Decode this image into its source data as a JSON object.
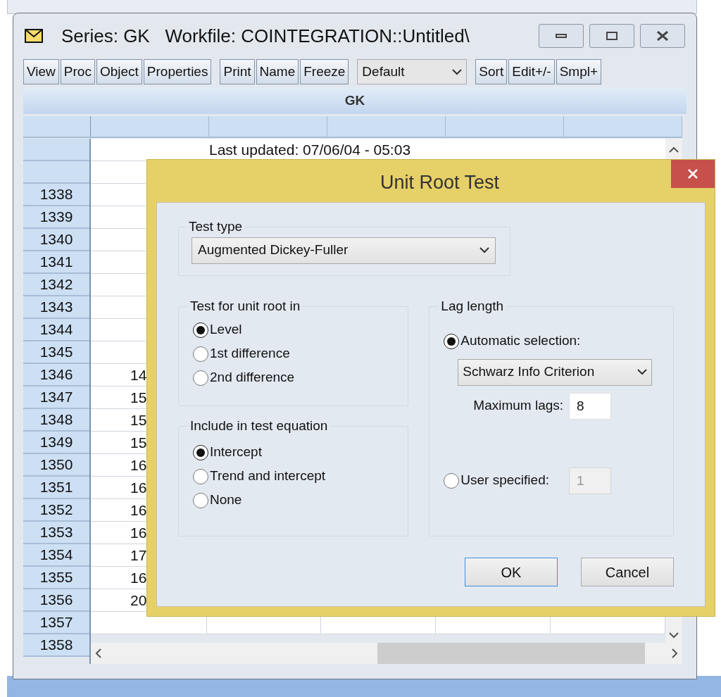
{
  "window": {
    "title": "Series: GK   Workfile: COINTEGRATION::Untitled\\"
  },
  "toolbar_groups": [
    [
      {
        "kind": "button",
        "label": "View"
      },
      {
        "kind": "button",
        "label": "Proc"
      },
      {
        "kind": "button",
        "label": "Object"
      },
      {
        "kind": "button",
        "label": "Properties"
      }
    ],
    [
      {
        "kind": "button",
        "label": "Print"
      },
      {
        "kind": "button",
        "label": "Name"
      },
      {
        "kind": "button",
        "label": "Freeze"
      }
    ],
    [
      {
        "kind": "dropdown",
        "label": "Default"
      }
    ],
    [
      {
        "kind": "button",
        "label": "Sort"
      },
      {
        "kind": "button",
        "label": "Edit+/-"
      },
      {
        "kind": "button",
        "label": "Smpl+"
      }
    ]
  ],
  "series_header": "GK",
  "sheet": {
    "note": "Last updated: 07/06/04 - 05:03",
    "rows": [
      {
        "label": "",
        "value": ""
      },
      {
        "label": "1338",
        "value": ""
      },
      {
        "label": "1339",
        "value": ""
      },
      {
        "label": "1340",
        "value": ""
      },
      {
        "label": "1341",
        "value": ""
      },
      {
        "label": "1342",
        "value": ""
      },
      {
        "label": "1343",
        "value": ""
      },
      {
        "label": "1344",
        "value": ""
      },
      {
        "label": "1345",
        "value": ""
      },
      {
        "label": "1346",
        "value": "14"
      },
      {
        "label": "1347",
        "value": "15"
      },
      {
        "label": "1348",
        "value": "15"
      },
      {
        "label": "1349",
        "value": "15"
      },
      {
        "label": "1350",
        "value": "16"
      },
      {
        "label": "1351",
        "value": "16"
      },
      {
        "label": "1352",
        "value": "16"
      },
      {
        "label": "1353",
        "value": "16"
      },
      {
        "label": "1354",
        "value": "17"
      },
      {
        "label": "1355",
        "value": "16"
      },
      {
        "label": "1356",
        "value": "20"
      },
      {
        "label": "1357",
        "value": ""
      },
      {
        "label": "1358",
        "value": ""
      }
    ]
  },
  "dialog": {
    "title": "Unit Root Test",
    "test_type": {
      "label": "Test type",
      "value": "Augmented Dickey-Fuller"
    },
    "unit_root": {
      "label": "Test for unit root in",
      "options": [
        {
          "label": "Level",
          "selected": true
        },
        {
          "label": "1st difference",
          "selected": false
        },
        {
          "label": "2nd difference",
          "selected": false
        }
      ]
    },
    "include": {
      "label": "Include in test equation",
      "options": [
        {
          "label": "Intercept",
          "selected": true
        },
        {
          "label": "Trend and intercept",
          "selected": false
        },
        {
          "label": "None",
          "selected": false
        }
      ]
    },
    "lag_length": {
      "label": "Lag length",
      "automatic": {
        "label": "Automatic selection:",
        "selected": true,
        "criterion": "Schwarz Info Criterion",
        "max_label": "Maximum lags:",
        "max_value": "8"
      },
      "user": {
        "label": "User specified:",
        "selected": false,
        "value": "1",
        "disabled": true
      }
    },
    "buttons": [
      {
        "label": "OK",
        "default": true
      },
      {
        "label": "Cancel",
        "default": false
      }
    ]
  }
}
